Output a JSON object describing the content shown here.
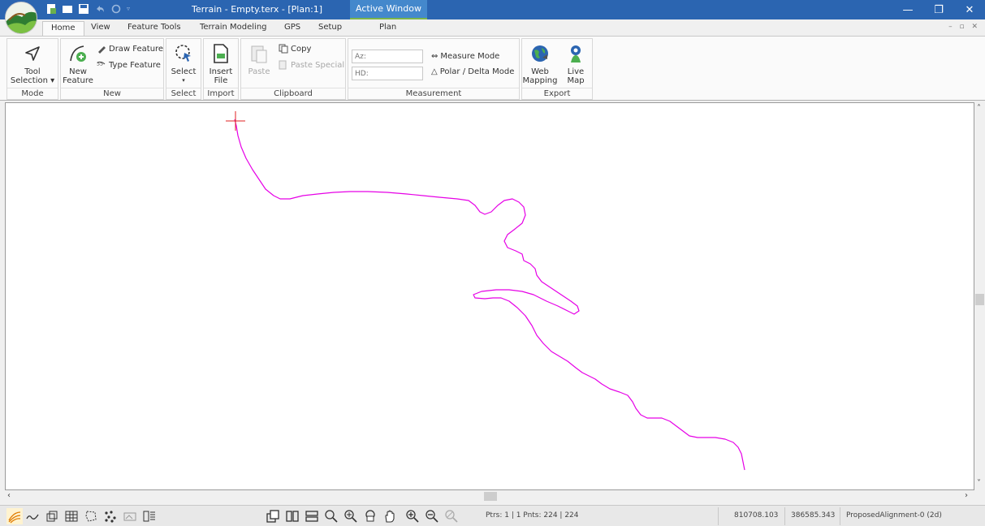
{
  "window": {
    "title": "Terrain - Empty.terx - [Plan:1]",
    "active_window_label": "Active Window",
    "min_glyph": "—",
    "restore_glyph": "❐",
    "close_glyph": "✕"
  },
  "tabs": [
    "Home",
    "View",
    "Feature Tools",
    "Terrain Modeling",
    "GPS",
    "Setup",
    "Plan"
  ],
  "active_tab": "Home",
  "ribbon": {
    "mode": {
      "label": "Mode",
      "tool_selection": "Tool\nSelection ▾"
    },
    "new": {
      "label": "New",
      "new_feature": "New\nFeature",
      "draw_feature": "Draw Feature",
      "type_feature": "Type Feature"
    },
    "select": {
      "label": "Select",
      "select_btn": "Select",
      "select_arrow": "▾"
    },
    "import": {
      "label": "Import",
      "insert_file": "Insert\nFile"
    },
    "clipboard": {
      "label": "Clipboard",
      "paste": "Paste",
      "copy": "Copy",
      "paste_special": "Paste Special"
    },
    "measurement": {
      "label": "Measurement",
      "az_placeholder": "Az:",
      "hd_placeholder": "HD:",
      "measure_mode": "Measure Mode",
      "polar_delta_mode": "Polar / Delta Mode"
    },
    "export": {
      "label": "Export",
      "web_mapping": "Web\nMapping",
      "live_map": "Live\nMap"
    }
  },
  "colors": {
    "titlebar": "#2b65b1",
    "alignment_line": "#e600e6",
    "cursor": "#e02020"
  },
  "status": {
    "points_info": "Ptrs: 1 | 1  Pnts: 224 | 224",
    "easting": "810708.103",
    "northing": "386585.343",
    "active_feature": "ProposedAlignment-0 (2d)"
  }
}
